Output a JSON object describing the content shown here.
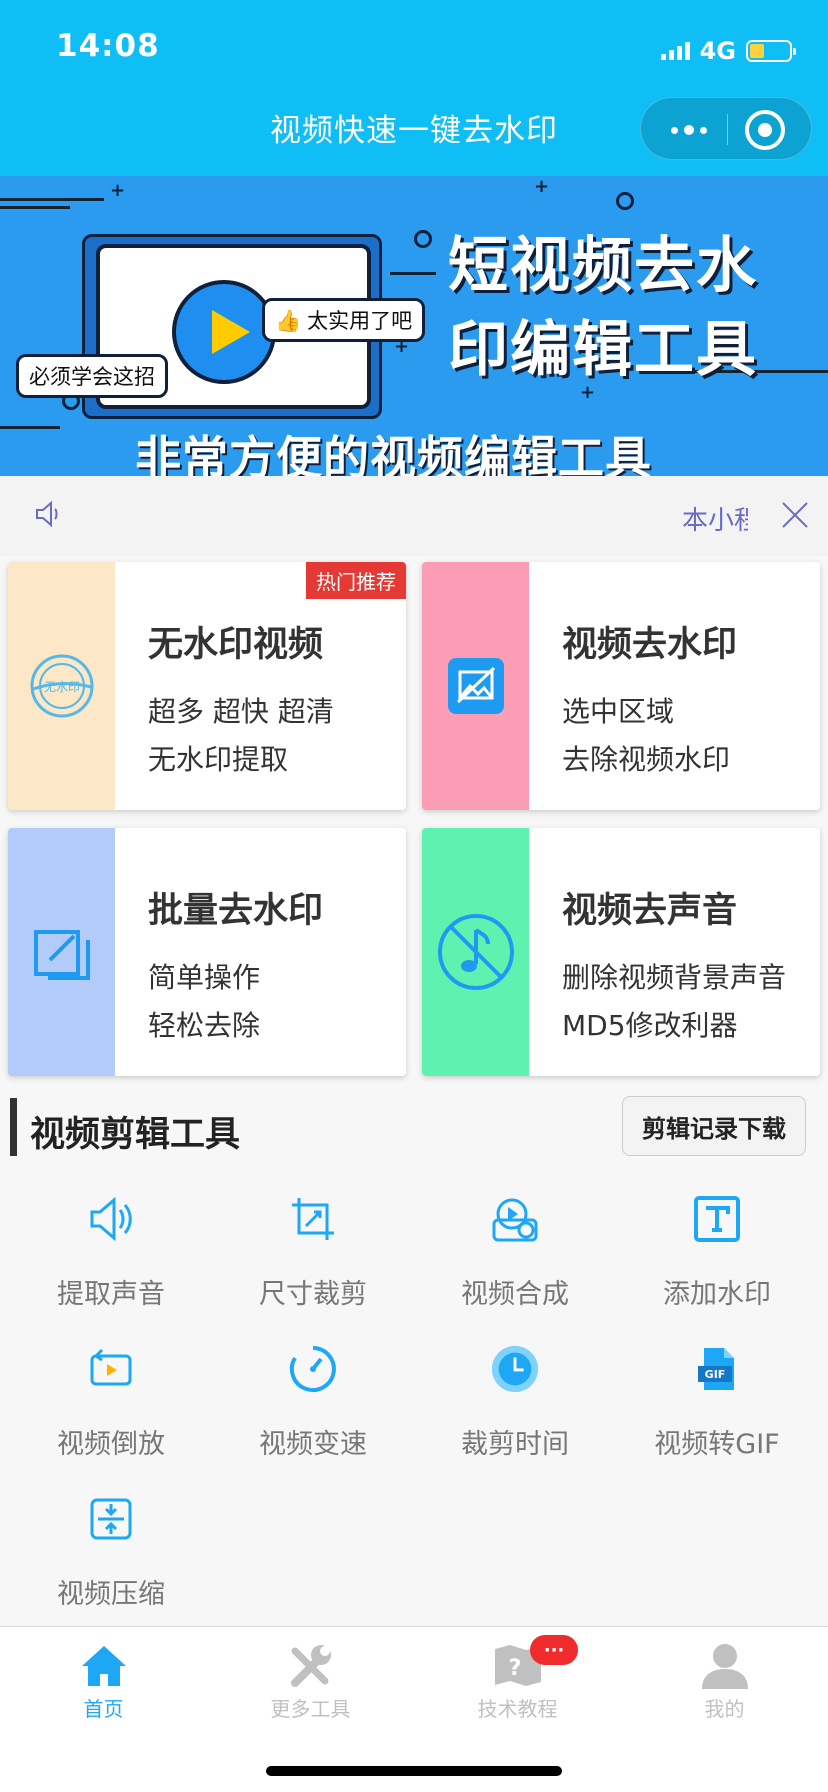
{
  "status": {
    "time": "14:08",
    "network": "4G"
  },
  "header": {
    "title": "视频快速一键去水印"
  },
  "banner": {
    "title_line1": "短视频去水",
    "title_line2": "印编辑工具",
    "subtitle": "非常方便的视频编辑工具",
    "bubble_left": "必须学会这招",
    "bubble_right": "太实用了吧"
  },
  "notice": {
    "text": "本小程序"
  },
  "cards": [
    {
      "title": "无水印视频",
      "line1": "超多 超快 超清",
      "line2": "无水印提取",
      "badge": "热门推荐",
      "color": "#fce7c6",
      "icon": "stamp-icon"
    },
    {
      "title": "视频去水印",
      "line1": "选中区域",
      "line2": "去除视频水印",
      "color": "#fb9eb5",
      "icon": "watermark-remove-icon"
    },
    {
      "title": "批量去水印",
      "line1": "简单操作",
      "line2": "轻松去除",
      "color": "#b3cbf8",
      "icon": "batch-edit-icon"
    },
    {
      "title": "视频去声音",
      "line1": "删除视频背景声音",
      "line2": "MD5修改利器",
      "color": "#5ef1b0",
      "icon": "mute-music-icon"
    }
  ],
  "section": {
    "title": "视频剪辑工具",
    "record_button": "剪辑记录下载"
  },
  "tools": [
    {
      "label": "提取声音",
      "icon": "speaker-icon"
    },
    {
      "label": "尺寸裁剪",
      "icon": "crop-icon"
    },
    {
      "label": "视频合成",
      "icon": "video-merge-icon"
    },
    {
      "label": "添加水印",
      "icon": "text-watermark-icon"
    },
    {
      "label": "视频倒放",
      "icon": "reverse-play-icon"
    },
    {
      "label": "视频变速",
      "icon": "speedometer-icon"
    },
    {
      "label": "裁剪时间",
      "icon": "clock-icon"
    },
    {
      "label": "视频转GIF",
      "icon": "gif-icon"
    },
    {
      "label": "视频压缩",
      "icon": "compress-icon"
    }
  ],
  "tabs": [
    {
      "label": "首页",
      "icon": "home-icon"
    },
    {
      "label": "更多工具",
      "icon": "tools-icon"
    },
    {
      "label": "技术教程",
      "icon": "tutorial-icon",
      "badge": "···"
    },
    {
      "label": "我的",
      "icon": "user-icon"
    }
  ],
  "colors": {
    "accent": "#0fbef5",
    "icon_blue": "#1ea7f5",
    "badge_red": "#e53935"
  }
}
